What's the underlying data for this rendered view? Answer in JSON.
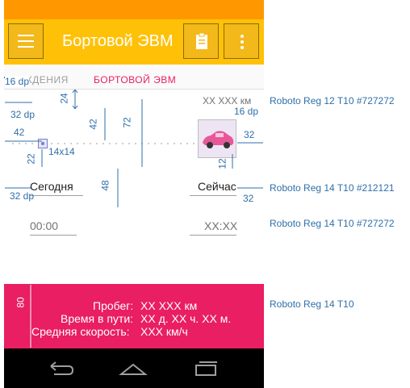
{
  "app": {
    "title": "Бортовой ЭВМ",
    "tabs": [
      "ОЖДЕНИЯ",
      "БОРТОВОЙ ЭВМ"
    ]
  },
  "fields": {
    "left_label": "Сегодня",
    "right_label": "Сейчас",
    "left_time_placeholder": "00:00",
    "right_time_placeholder": "XX:XX",
    "distance_top": "XX XXX км"
  },
  "stats": [
    {
      "label": "Пробег:",
      "value": "XX XXX км"
    },
    {
      "label": "Время в пути:",
      "value": "XX д. XX ч. XX м."
    },
    {
      "label": "Средняя скорость:",
      "value": "XXX км/ч"
    }
  ],
  "annotations": {
    "dims": [
      "16 dp",
      "24",
      "32 dp",
      "42",
      "42",
      "72",
      "14x14",
      "22",
      "48",
      "16 dp",
      "32",
      "12",
      "32 dp",
      "32",
      "80"
    ],
    "notes": [
      "Roboto Reg 12 T10 #727272",
      "Roboto Reg 14 T10 #212121",
      "Roboto Reg 14 T10 #727272",
      "Roboto Reg 14 T10"
    ]
  },
  "colors": {
    "status_bar": "#ff9800",
    "app_bar": "#ffc107",
    "accent": "#e91e63",
    "annotation": "#2f6fa8",
    "text_primary": "#212121",
    "text_hint": "#727272"
  }
}
